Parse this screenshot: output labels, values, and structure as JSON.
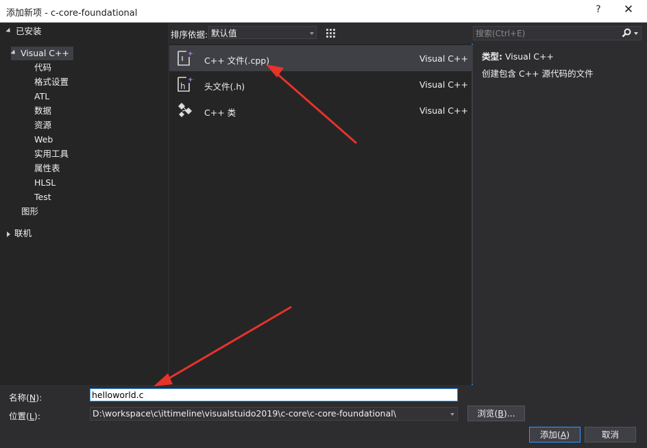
{
  "window": {
    "title": "添加新项 - c-core-foundational",
    "help": "?",
    "close": "✕"
  },
  "tree": {
    "installed": "已安装",
    "visual_cpp": "Visual C++",
    "children": [
      "代码",
      "格式设置",
      "ATL",
      "数据",
      "资源",
      "Web",
      "实用工具",
      "属性表",
      "HLSL",
      "Test"
    ],
    "graphics": "图形",
    "online": "联机"
  },
  "sort": {
    "label": "排序依据:",
    "value": "默认值"
  },
  "search": {
    "placeholder": "搜索(Ctrl+E)"
  },
  "templates": [
    {
      "name": "C++ 文件(.cpp)",
      "lang": "Visual C++",
      "icon": "cpp-file-icon"
    },
    {
      "name": "头文件(.h)",
      "lang": "Visual C++",
      "icon": "header-file-icon"
    },
    {
      "name": "C++ 类",
      "lang": "Visual C++",
      "icon": "cpp-class-icon"
    }
  ],
  "details": {
    "type_label": "类型:",
    "type_value": "Visual C++",
    "description": "创建包含 C++ 源代码的文件"
  },
  "form": {
    "name_label_pre": "名称(",
    "name_label_key": "N",
    "name_label_post": "):",
    "name_value": "helloworld.c",
    "location_label_pre": "位置(",
    "location_label_key": "L",
    "location_label_post": "):",
    "location_value": "D:\\workspace\\c\\ittimeline\\visualstuido2019\\c-core\\c-core-foundational\\",
    "browse_pre": "浏览(",
    "browse_key": "B",
    "browse_post": ")...",
    "add_pre": "添加(",
    "add_key": "A",
    "add_post": ")",
    "cancel": "取消"
  },
  "colors": {
    "accent": "#3399ff",
    "annotation": "#e8332a",
    "icon_purple": "#c586f5"
  }
}
